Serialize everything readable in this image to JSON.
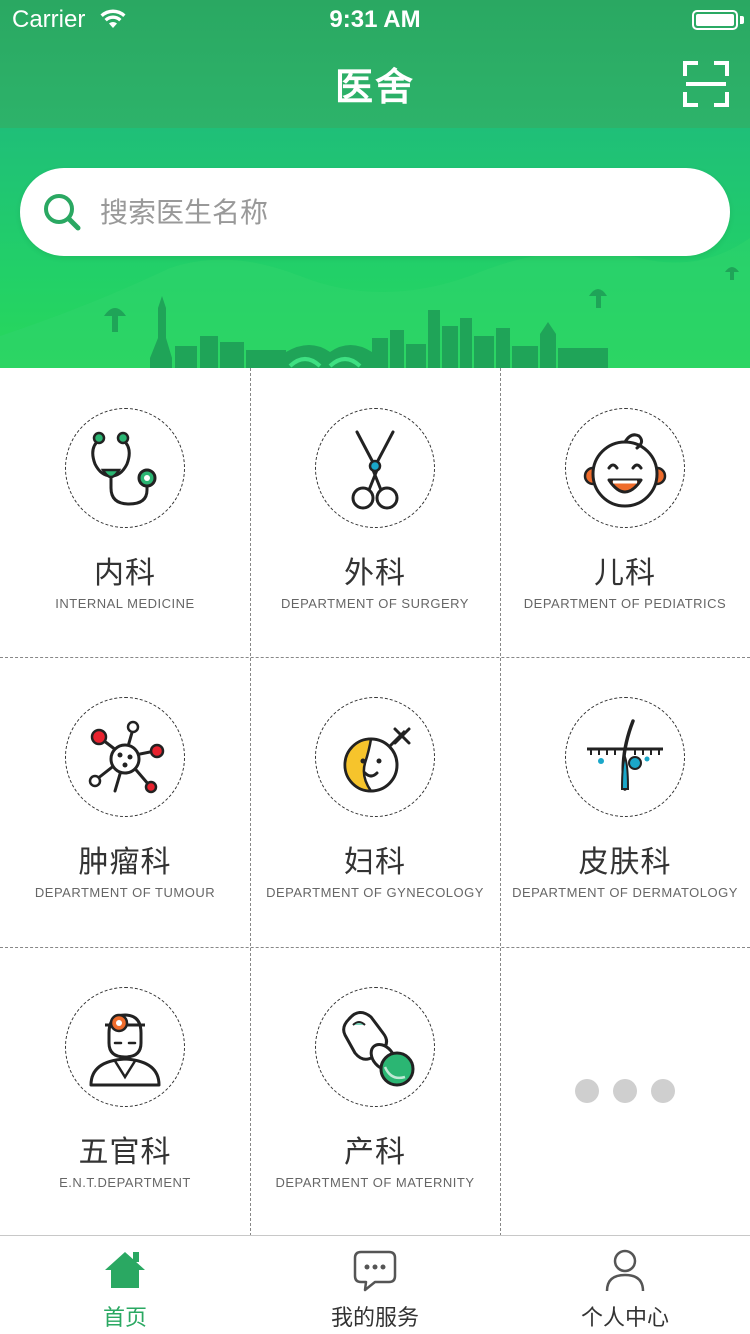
{
  "status_bar": {
    "carrier": "Carrier",
    "time": "9:31 AM"
  },
  "nav": {
    "title": "医舍",
    "scan_icon": "scan-icon"
  },
  "search": {
    "placeholder": "搜索医生名称",
    "icon": "search-icon"
  },
  "colors": {
    "brand": "#2aa862",
    "hero_green": "#22d068",
    "text": "#333333",
    "muted": "#999999"
  },
  "departments": [
    {
      "name": "内科",
      "en": "INTERNAL MEDICINE",
      "icon": "stethoscope-icon"
    },
    {
      "name": "外科",
      "en": "DEPARTMENT OF SURGERY",
      "icon": "scissors-icon"
    },
    {
      "name": "儿科",
      "en": "DEPARTMENT OF PEDIATRICS",
      "icon": "baby-face-icon"
    },
    {
      "name": "肿瘤科",
      "en": "DEPARTMENT OF TUMOUR",
      "icon": "molecule-icon"
    },
    {
      "name": "妇科",
      "en": "DEPARTMENT OF GYNECOLOGY",
      "icon": "female-face-icon"
    },
    {
      "name": "皮肤科",
      "en": "DEPARTMENT OF DERMATOLOGY",
      "icon": "skin-hair-icon"
    },
    {
      "name": "五官科",
      "en": "E.N.T.DEPARTMENT",
      "icon": "ent-doctor-icon"
    },
    {
      "name": "产科",
      "en": "DEPARTMENT OF MATERNITY",
      "icon": "pacifier-icon"
    }
  ],
  "more_icon": "more-dots-icon",
  "tabbar": [
    {
      "label": "首页",
      "icon": "home-icon",
      "active": true
    },
    {
      "label": "我的服务",
      "icon": "chat-bubble-icon",
      "active": false
    },
    {
      "label": "个人中心",
      "icon": "person-icon",
      "active": false
    }
  ]
}
